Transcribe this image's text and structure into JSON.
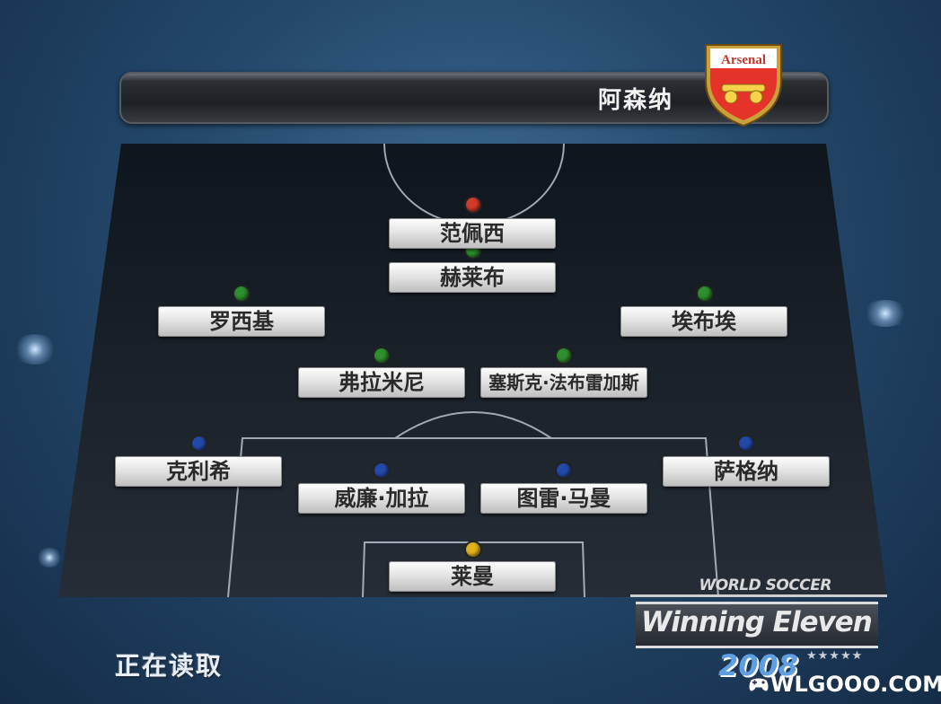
{
  "team": {
    "name": "阿森纳",
    "crest_text": "Arsenal"
  },
  "players": [
    {
      "name": "范佩西",
      "role": "FW",
      "dot_color": "#d23a2a"
    },
    {
      "name": "赫莱布",
      "role": "MF",
      "dot_color": "#2e8f2e"
    },
    {
      "name": "罗西基",
      "role": "MF",
      "dot_color": "#2e8f2e"
    },
    {
      "name": "埃布埃",
      "role": "MF",
      "dot_color": "#2e8f2e"
    },
    {
      "name": "弗拉米尼",
      "role": "MF",
      "dot_color": "#2e8f2e"
    },
    {
      "name": "塞斯克·法布雷加斯",
      "role": "MF",
      "dot_color": "#2e8f2e"
    },
    {
      "name": "克利希",
      "role": "DF",
      "dot_color": "#2349a8"
    },
    {
      "name": "萨格纳",
      "role": "DF",
      "dot_color": "#2349a8"
    },
    {
      "name": "威廉·加拉",
      "role": "DF",
      "dot_color": "#2349a8"
    },
    {
      "name": "图雷·马曼",
      "role": "DF",
      "dot_color": "#2349a8"
    },
    {
      "name": "莱曼",
      "role": "GK",
      "dot_color": "#e0b21c"
    }
  ],
  "status": {
    "loading_text": "正在读取"
  },
  "logo": {
    "top_text": "WORLD SOCCER",
    "main_text": "Winning Eleven",
    "year": "2008",
    "stars": "★★★★★"
  },
  "watermark": {
    "text": "WLGOOO.COM"
  }
}
